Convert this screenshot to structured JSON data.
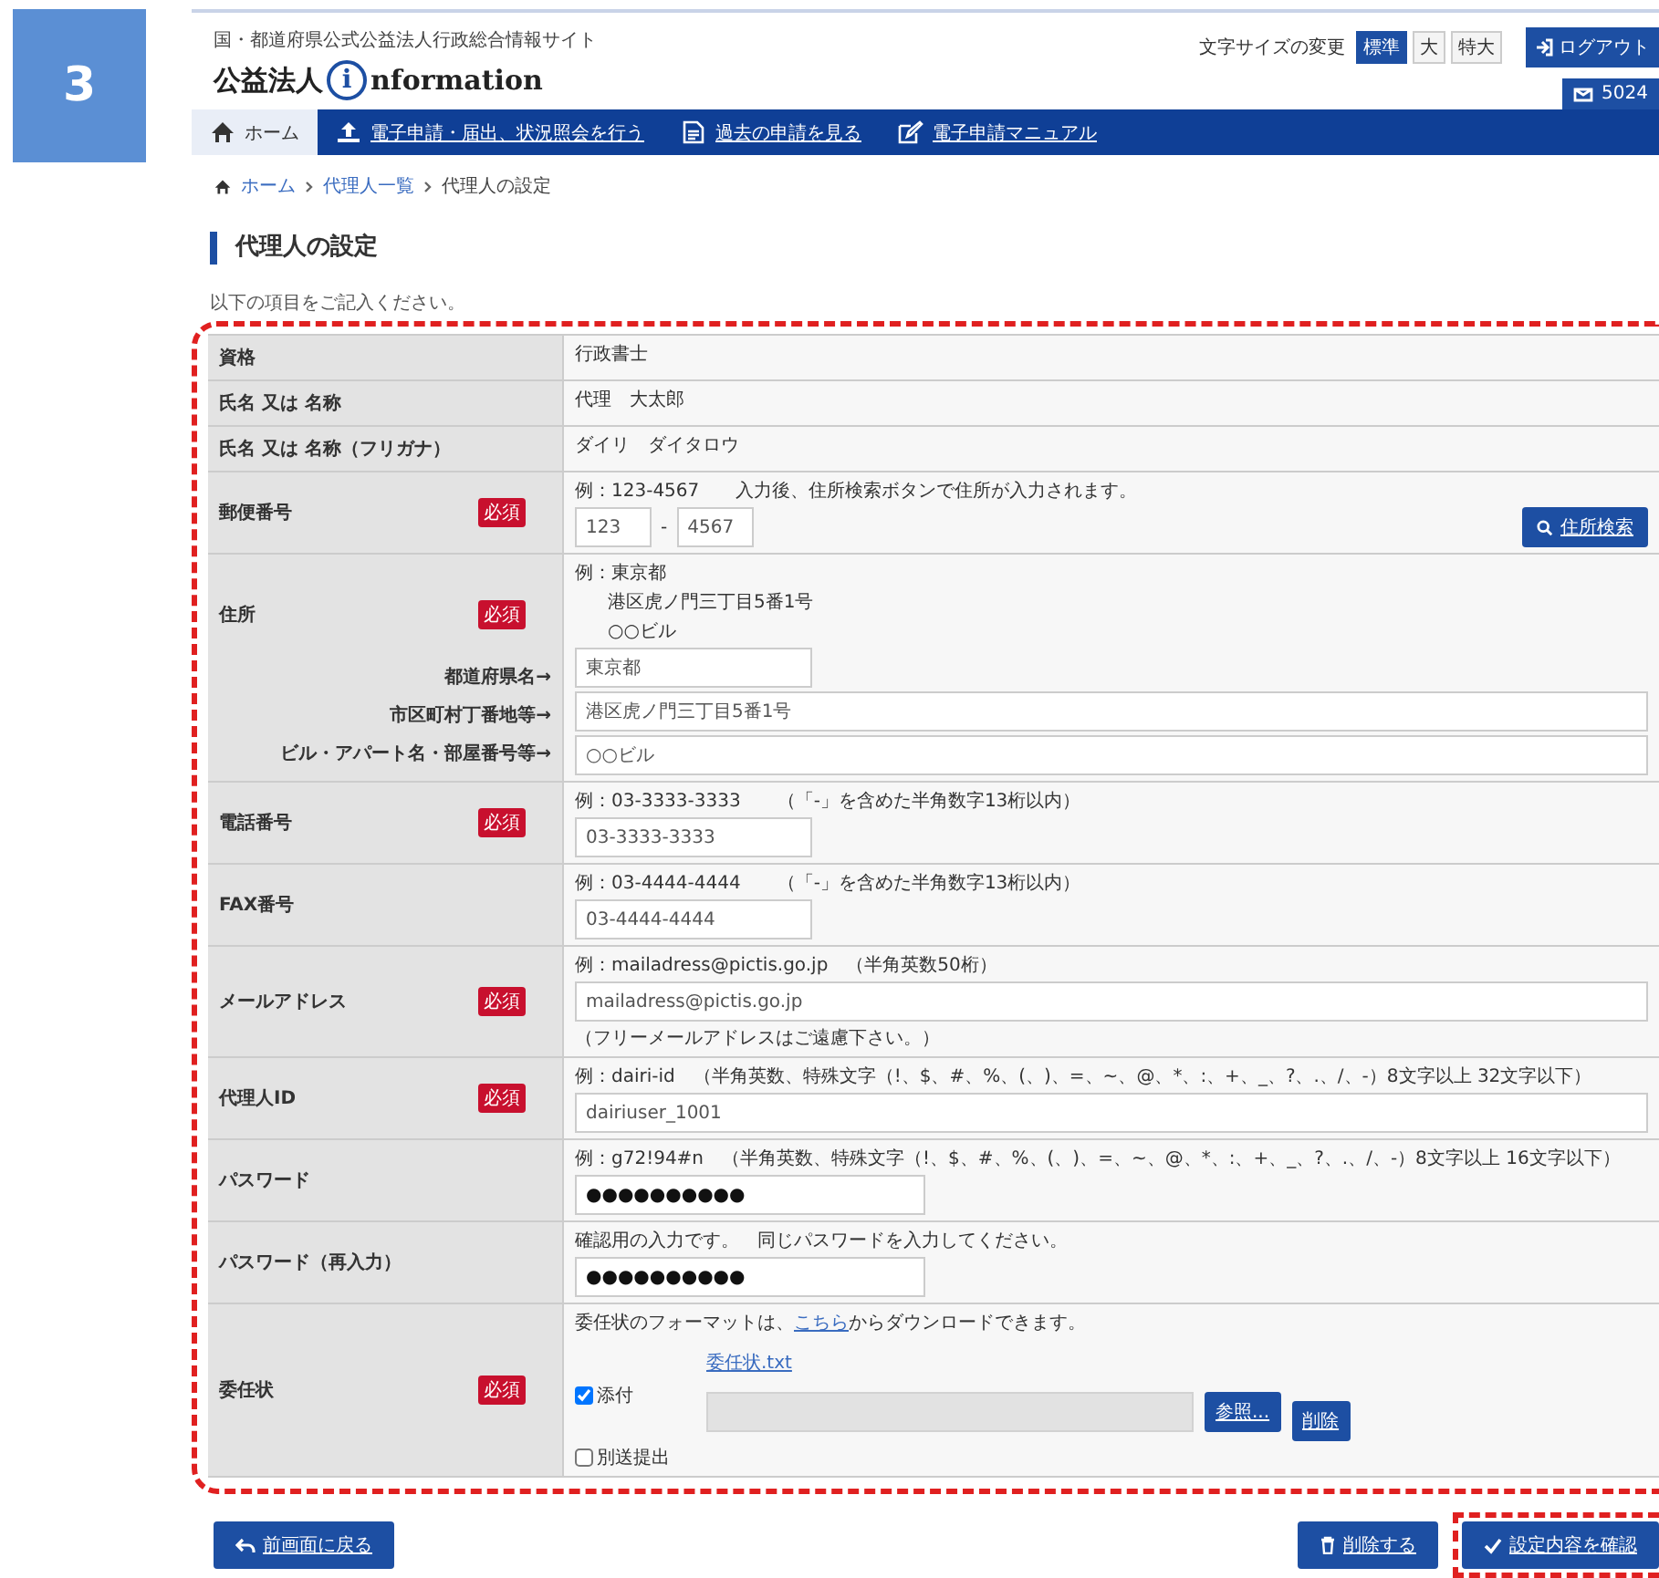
{
  "badge": "3",
  "header": {
    "site_subtitle": "国・都道府県公式公益法人行政総合情報サイト",
    "logo_text": "公益法人",
    "logo_letter": "i",
    "logo_suffix": "nformation",
    "font_size_label": "文字サイズの変更",
    "font_sizes": [
      {
        "label": "標準",
        "selected": true
      },
      {
        "label": "大",
        "selected": false
      },
      {
        "label": "特大",
        "selected": false
      }
    ],
    "logout": "ログアウト",
    "user_id": "5024"
  },
  "nav": [
    {
      "label": "ホーム",
      "kind": "home",
      "selected": true
    },
    {
      "label": "電子申請・届出、状況照会を行う",
      "kind": "upload",
      "selected": false
    },
    {
      "label": "過去の申請を見る",
      "kind": "document",
      "selected": false
    },
    {
      "label": "電子申請マニュアル",
      "kind": "edit",
      "selected": false
    }
  ],
  "breadcrumb": [
    "ホーム",
    "代理人一覧",
    "代理人の設定"
  ],
  "title": "代理人の設定",
  "instruction": "以下の項目をご記入ください。",
  "rows": [
    {
      "kind": "text",
      "label": "資格",
      "value": "行政書士"
    },
    {
      "kind": "text",
      "label": "氏名 又は 名称",
      "value": "代理　大太郎"
    },
    {
      "kind": "text",
      "label": "氏名 又は 名称（フリガナ）",
      "value": "ダイリ　ダイタロウ"
    },
    {
      "kind": "postal",
      "label": "郵便番号",
      "required_badge": "必須",
      "hint": "例：123-4567　　入力後、住所検索ボタンで住所が入力されます。",
      "first": "123",
      "separator": "-",
      "second": "4567",
      "button": "住所検索"
    },
    {
      "kind": "address",
      "label": "住所",
      "required_badge": "必須",
      "hint_lines": [
        "例：東京都",
        "港区虎ノ門三丁目5番1号",
        "○○ビル"
      ],
      "fields": [
        {
          "label": "都道府県名→",
          "value": "東京都"
        },
        {
          "label": "市区町村丁番地等→",
          "value": "港区虎ノ門三丁目5番1号"
        },
        {
          "label": "ビル・アパート名・部屋番号等→",
          "value": "○○ビル"
        }
      ]
    },
    {
      "kind": "short",
      "label": "電話番号",
      "required_badge": "必須",
      "hint": "例：03-3333-3333　　（「-」を含めた半角数字13桁以内）",
      "value": "03-3333-3333"
    },
    {
      "kind": "short",
      "label": "FAX番号",
      "hint": "例：03-4444-4444　　（「-」を含めた半角数字13桁以内）",
      "value": "03-4444-4444"
    },
    {
      "kind": "long",
      "label": "メールアドレス",
      "required_badge": "必須",
      "hint": "例：mailadress@pictis.go.jp　（半角英数50桁）",
      "value": "mailadress@pictis.go.jp",
      "note": "（フリーメールアドレスはご遠慮下さい。）"
    },
    {
      "kind": "long",
      "label": "代理人ID",
      "required_badge": "必須",
      "hint": "例：dairi-id　（半角英数、特殊文字（!、$、#、%、(、)、=、~、@、*、:、+、_、?、.、/、-）8文字以上 32文字以下）",
      "value": "dairiuser_1001"
    },
    {
      "kind": "password",
      "label": "パスワード",
      "hint": "例：g72!94#n　（半角英数、特殊文字（!、$、#、%、(、)、=、~、@、*、:、+、_、?、.、/、-）8文字以上 16文字以下）",
      "value": "●●●●●●●●●●"
    },
    {
      "kind": "password",
      "label": "パスワード（再入力）",
      "hint": "確認用の入力です。　同じパスワードを入力してください。",
      "value": "●●●●●●●●●●"
    },
    {
      "kind": "attachment",
      "label": "委任状",
      "required_badge": "必須",
      "hint_before": "委任状のフォーマットは、",
      "hint_link": "こちら",
      "hint_after": "からダウンロードできます。",
      "attach": {
        "label": "添付",
        "checked": true
      },
      "file_name": "委任状.txt",
      "browse": "参照...",
      "delete": "削除",
      "separate": {
        "label": "別送提出",
        "checked": false
      }
    }
  ],
  "footer": {
    "back": "前画面に戻る",
    "delete": "削除する",
    "confirm": "設定内容を確認"
  }
}
